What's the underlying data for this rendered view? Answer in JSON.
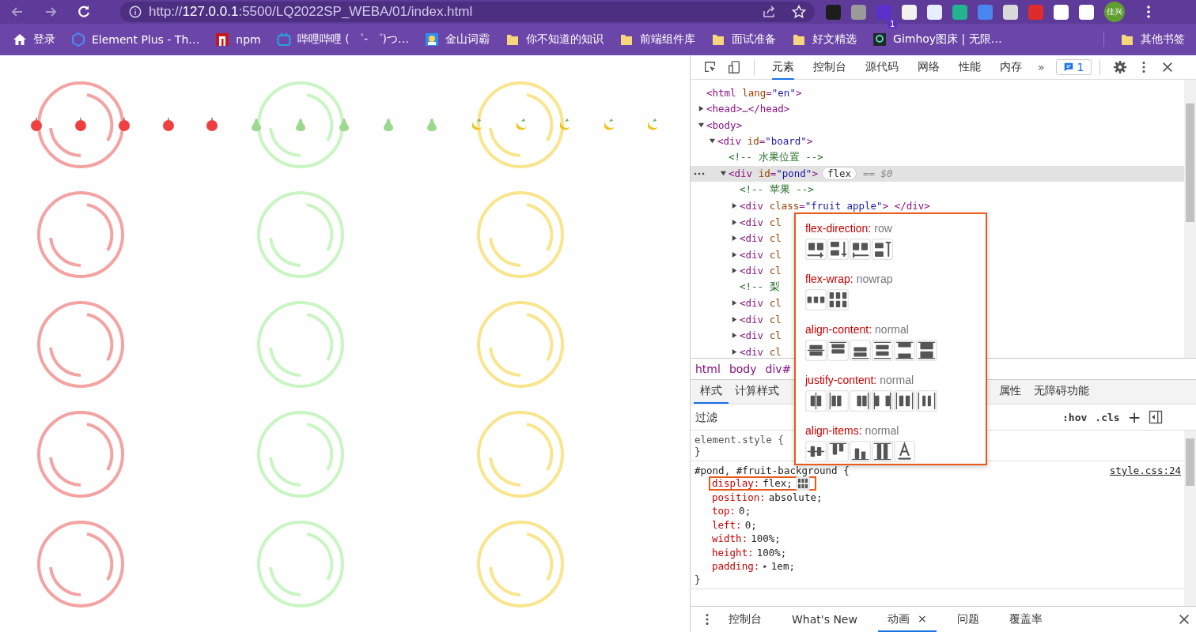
{
  "browser": {
    "url": {
      "scheme": "http://",
      "host": "127.0.0.1",
      "path": ":5500/LQ2022SP_WEBA/01/index.html"
    },
    "extension_badge": "1",
    "profile": "佳兴"
  },
  "bookmarks": [
    {
      "kind": "home",
      "label": "登录"
    },
    {
      "kind": "hexagon",
      "label": "Element Plus - Th…"
    },
    {
      "kind": "npm-block",
      "label": "npm"
    },
    {
      "kind": "tv",
      "label": "哔哩哔哩 ( ゜- ゜)つ…"
    },
    {
      "kind": "portrait",
      "label": "金山词霸"
    },
    {
      "kind": "folder",
      "label": "你不知道的知识"
    },
    {
      "kind": "folder",
      "label": "前端组件库"
    },
    {
      "kind": "folder",
      "label": "面试准备"
    },
    {
      "kind": "folder",
      "label": "好文精选"
    },
    {
      "kind": "emblem",
      "label": "Gimhoy图床 | 无限…"
    }
  ],
  "other_bookmarks": {
    "kind": "folder",
    "label": "其他书签"
  },
  "page": {
    "pond": [
      {
        "kind": "apple"
      },
      {
        "kind": "apple"
      },
      {
        "kind": "apple"
      },
      {
        "kind": "apple"
      },
      {
        "kind": "apple"
      },
      {
        "kind": "pear"
      },
      {
        "kind": "pear"
      },
      {
        "kind": "pear"
      },
      {
        "kind": "pear"
      },
      {
        "kind": "pear"
      },
      {
        "kind": "banana"
      },
      {
        "kind": "banana"
      },
      {
        "kind": "banana"
      },
      {
        "kind": "banana"
      },
      {
        "kind": "banana"
      }
    ],
    "bins": [
      {
        "kind": "apple"
      },
      {
        "kind": "pear"
      },
      {
        "kind": "banana"
      },
      {
        "kind": "apple"
      },
      {
        "kind": "pear"
      },
      {
        "kind": "banana"
      },
      {
        "kind": "apple"
      },
      {
        "kind": "pear"
      },
      {
        "kind": "banana"
      },
      {
        "kind": "apple"
      },
      {
        "kind": "pear"
      },
      {
        "kind": "banana"
      },
      {
        "kind": "apple"
      },
      {
        "kind": "pear"
      },
      {
        "kind": "banana"
      }
    ]
  },
  "devtools": {
    "tabs": [
      {
        "label": "元素",
        "selected": true
      },
      {
        "label": "控制台",
        "selected": false
      },
      {
        "label": "源代码",
        "selected": false
      },
      {
        "label": "网络",
        "selected": false
      },
      {
        "label": "性能",
        "selected": false
      },
      {
        "label": "内存",
        "selected": false
      }
    ],
    "more": "»",
    "issues": "1",
    "tree": [
      {
        "selected": false,
        "parts": [
          {
            "kind": "tag",
            "text": "<html"
          },
          {
            "kind": "attr",
            "text": " lang"
          },
          {
            "kind": "tag",
            "text": "="
          },
          {
            "kind": "value",
            "text": "\"en\""
          },
          {
            "kind": "tag",
            "text": ">"
          }
        ]
      },
      {
        "selected": false,
        "expanded": false,
        "parts": [
          {
            "kind": "tag",
            "text": "<head>…</head>"
          }
        ]
      },
      {
        "selected": false,
        "expanded": true,
        "parts": [
          {
            "kind": "tag",
            "text": "<body>"
          }
        ],
        "children": [
          {
            "selected": false,
            "expanded": true,
            "parts": [
              {
                "kind": "tag",
                "text": "<div"
              },
              {
                "kind": "attr",
                "text": " id"
              },
              {
                "kind": "tag",
                "text": "="
              },
              {
                "kind": "value",
                "text": "\"board\""
              },
              {
                "kind": "tag",
                "text": ">"
              }
            ],
            "children": [
              {
                "selected": false,
                "parts": [
                  {
                    "kind": "comment",
                    "text": "<!-- 水果位置 -->"
                  }
                ]
              },
              {
                "selected": true,
                "expanded": true,
                "badge": "flex",
                "suffix": "== $0",
                "parts": [
                  {
                    "kind": "tag",
                    "text": "<div"
                  },
                  {
                    "kind": "attr",
                    "text": " id"
                  },
                  {
                    "kind": "tag",
                    "text": "="
                  },
                  {
                    "kind": "value",
                    "text": "\"pond\""
                  },
                  {
                    "kind": "tag",
                    "text": ">"
                  }
                ],
                "children": [
                  {
                    "selected": false,
                    "parts": [
                      {
                        "kind": "comment",
                        "text": "<!-- 苹果 -->"
                      }
                    ]
                  },
                  {
                    "selected": false,
                    "expanded": false,
                    "parts": [
                      {
                        "kind": "tag",
                        "text": "<div"
                      },
                      {
                        "kind": "attr",
                        "text": " class"
                      },
                      {
                        "kind": "tag",
                        "text": "="
                      },
                      {
                        "kind": "value",
                        "text": "\"fruit apple\""
                      },
                      {
                        "kind": "tag",
                        "text": "> </div>"
                      }
                    ]
                  },
                  {
                    "selected": false,
                    "expanded": false,
                    "parts": [
                      {
                        "kind": "tag",
                        "text": "<div"
                      },
                      {
                        "kind": "attr",
                        "text": " cl"
                      }
                    ]
                  },
                  {
                    "selected": false,
                    "expanded": false,
                    "parts": [
                      {
                        "kind": "tag",
                        "text": "<div"
                      },
                      {
                        "kind": "attr",
                        "text": " cl"
                      }
                    ]
                  },
                  {
                    "selected": false,
                    "expanded": false,
                    "parts": [
                      {
                        "kind": "tag",
                        "text": "<div"
                      },
                      {
                        "kind": "attr",
                        "text": " cl"
                      }
                    ]
                  },
                  {
                    "selected": false,
                    "expanded": false,
                    "parts": [
                      {
                        "kind": "tag",
                        "text": "<div"
                      },
                      {
                        "kind": "attr",
                        "text": " cl"
                      }
                    ]
                  },
                  {
                    "selected": false,
                    "parts": [
                      {
                        "kind": "comment",
                        "text": "<!-- 梨"
                      }
                    ]
                  },
                  {
                    "selected": false,
                    "expanded": false,
                    "parts": [
                      {
                        "kind": "tag",
                        "text": "<div"
                      },
                      {
                        "kind": "attr",
                        "text": " cl"
                      }
                    ]
                  },
                  {
                    "selected": false,
                    "expanded": false,
                    "parts": [
                      {
                        "kind": "tag",
                        "text": "<div"
                      },
                      {
                        "kind": "attr",
                        "text": " cl"
                      }
                    ]
                  },
                  {
                    "selected": false,
                    "expanded": false,
                    "parts": [
                      {
                        "kind": "tag",
                        "text": "<div"
                      },
                      {
                        "kind": "attr",
                        "text": " cl"
                      }
                    ]
                  },
                  {
                    "selected": false,
                    "expanded": false,
                    "parts": [
                      {
                        "kind": "tag",
                        "text": "<div"
                      },
                      {
                        "kind": "attr",
                        "text": " cl"
                      }
                    ]
                  }
                ]
              }
            ]
          }
        ]
      }
    ],
    "breadcrumbs": [
      "html",
      "body",
      "div#"
    ],
    "style_tabs": [
      {
        "label": "样式",
        "selected": true
      },
      {
        "label": "计算样式",
        "selected": false
      },
      {
        "label": "属性",
        "selected": false
      },
      {
        "label": "无障碍功能",
        "selected": false
      }
    ],
    "filter": {
      "placeholder": "过滤"
    },
    "hov": ":hov",
    "cls": ".cls",
    "add": "+",
    "rules": [
      {
        "selector": "element.style {",
        "close": "}"
      },
      {
        "selector": "#pond, #fruit-background {",
        "source": "style.css:24",
        "close": "}",
        "decls": [
          {
            "prop": "display:",
            "value": "flex;",
            "highlighted": true,
            "editor": true
          },
          {
            "prop": "position:",
            "value": "absolute;",
            "highlighted": false
          },
          {
            "prop": "top:",
            "value": "0;",
            "highlighted": false
          },
          {
            "prop": "left:",
            "value": "0;",
            "highlighted": false
          },
          {
            "prop": "width:",
            "value": "100%;",
            "highlighted": false
          },
          {
            "prop": "height:",
            "value": "100%;",
            "highlighted": false
          },
          {
            "prop": "padding:",
            "toggle": "▸",
            "value": "1em;",
            "highlighted": false
          }
        ]
      }
    ],
    "flex_editor": [
      {
        "property": "flex-direction:",
        "value": "row",
        "buttons": [
          {
            "kind": "row"
          },
          {
            "kind": "column"
          },
          {
            "kind": "row-reverse"
          },
          {
            "kind": "column-reverse"
          }
        ]
      },
      {
        "property": "flex-wrap:",
        "value": "nowrap",
        "buttons": [
          {
            "kind": "nowrap"
          },
          {
            "kind": "wrap"
          }
        ]
      },
      {
        "property": "align-content:",
        "value": "normal",
        "buttons": [
          {
            "kind": "ac-center"
          },
          {
            "kind": "ac-start"
          },
          {
            "kind": "ac-end"
          },
          {
            "kind": "ac-around"
          },
          {
            "kind": "ac-between"
          },
          {
            "kind": "ac-stretch"
          }
        ]
      },
      {
        "property": "justify-content:",
        "value": "normal",
        "buttons": [
          {
            "kind": "jc-center"
          },
          {
            "kind": "jc-start"
          },
          {
            "kind": "jc-end"
          },
          {
            "kind": "jc-between"
          },
          {
            "kind": "jc-around"
          },
          {
            "kind": "jc-evenly"
          }
        ]
      },
      {
        "property": "align-items:",
        "value": "normal",
        "buttons": [
          {
            "kind": "ai-center"
          },
          {
            "kind": "ai-start"
          },
          {
            "kind": "ai-end"
          },
          {
            "kind": "ai-stretch"
          },
          {
            "kind": "ai-baseline"
          }
        ]
      }
    ],
    "drawer_tabs": [
      {
        "label": "控制台",
        "selected": false
      },
      {
        "label": "What's New",
        "selected": false
      },
      {
        "label": "动画",
        "selected": true,
        "close": "×"
      },
      {
        "label": "问题",
        "selected": false
      },
      {
        "label": "覆盖率",
        "selected": false
      }
    ]
  }
}
